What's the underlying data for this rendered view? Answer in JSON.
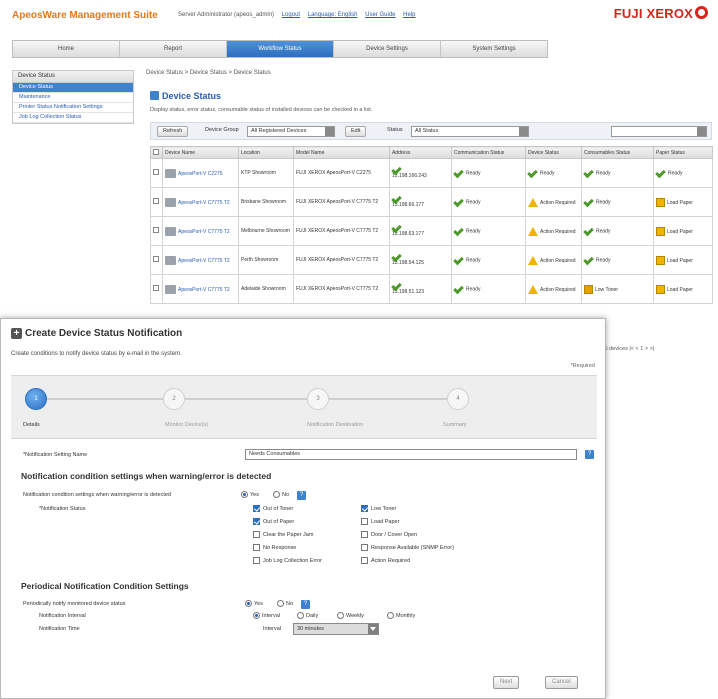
{
  "header": {
    "app_title": "ApeosWare Management Suite",
    "user_text": "Server Administrator (apeos_admin)",
    "logout": "Logout",
    "language": "Language: English",
    "user_guide": "User Guide",
    "help": "Help",
    "brand": "FUJI XEROX"
  },
  "nav": [
    "Home",
    "Report",
    "Workflow Status",
    "Device Settings",
    "System Settings"
  ],
  "sidebar": {
    "header": "Device Status",
    "items": [
      "Device Status",
      "Maintenance",
      "Printer Status Notification Settings",
      "Job Log Collection Status"
    ]
  },
  "background": {
    "breadcrumb": "Device Status  >  Device Status  >  Device Status",
    "title": "Device Status",
    "description": "Display status, error status, consumable status of installed devices can be checked in a list.",
    "toolbar": {
      "button_left": "Refresh",
      "group_label": "Device Group",
      "group_value": "All Registered Devices",
      "edit": "Edit",
      "status_label": "Status",
      "status_value": "All Status"
    },
    "columns": [
      "",
      "Device Name",
      "Location",
      "Model Name",
      "Address",
      "Communication Status",
      "Device Status",
      "Consumables Status",
      "Paper Status"
    ],
    "rows": [
      {
        "name": "ApeosPort-V C2275",
        "location": "KTP Showroom",
        "model": "FUJI XEROX ApeosPort-V C2275",
        "address": "13.198.166.243",
        "comm": "Ready",
        "device": "Ready",
        "device_warn": false,
        "cons": "Ready",
        "cons_warn": false,
        "paper": "Ready",
        "paper_warn": false
      },
      {
        "name": "ApeosPort-V C7775 T2",
        "location": "Brisbane Showroom",
        "model": "FUJI XEROX ApeosPort-V C7775 T2",
        "address": "13.198.66.177",
        "comm": "Ready",
        "device": "Action Required",
        "device_warn": true,
        "cons": "Ready",
        "cons_warn": false,
        "paper": "Load Paper",
        "paper_warn": true
      },
      {
        "name": "ApeosPort-V C7775 T2",
        "location": "Melbourne Showroom",
        "model": "FUJI XEROX ApeosPort-V C7775 T2",
        "address": "13.198.63.177",
        "comm": "Ready",
        "device": "Action Required",
        "device_warn": true,
        "cons": "Ready",
        "cons_warn": false,
        "paper": "Load Paper",
        "paper_warn": true
      },
      {
        "name": "ApeosPort-V C7775 T2",
        "location": "Perth Showroom",
        "model": "FUJI XEROX ApeosPort-V C7775 T2",
        "address": "13.198.54.125",
        "comm": "Ready",
        "device": "Action Required",
        "device_warn": true,
        "cons": "Ready",
        "cons_warn": false,
        "paper": "Load Paper",
        "paper_warn": true
      },
      {
        "name": "ApeosPort-V C7775 T2",
        "location": "Adelaide Showroom",
        "model": "FUJI XEROX ApeosPort-V C7775 T2",
        "address": "13.198.51.123",
        "comm": "Ready",
        "device": "Action Required",
        "device_warn": true,
        "cons": "Low Toner",
        "cons_warn": true,
        "paper": "Load Paper",
        "paper_warn": true
      }
    ],
    "pager": "6/6 devices   |<   <   1   >   >|"
  },
  "modal": {
    "title": "Create Device Status Notification",
    "description": "Create conditions to notify device status by e-mail in the system.",
    "required_note": "*Required",
    "steps": [
      {
        "num": "1",
        "label": "Details"
      },
      {
        "num": "2",
        "label": "Monitor Device(s)"
      },
      {
        "num": "3",
        "label": "Notification Destination"
      },
      {
        "num": "4",
        "label": "Summary"
      }
    ],
    "setting_name_label": "*Notification Setting Name",
    "setting_name_value": "Needs Consumables",
    "section1_title": "Notification condition settings when warning/error is detected",
    "condition_question": "Notification condition settings when warning/error is detected",
    "yes": "Yes",
    "no": "No",
    "status_label": "*Notification Status",
    "statuses": [
      {
        "label": "Out of Toner",
        "checked": true
      },
      {
        "label": "Low Toner",
        "checked": true
      },
      {
        "label": "Out of Paper",
        "checked": true
      },
      {
        "label": "Load Paper",
        "checked": false
      },
      {
        "label": "Clear the Paper Jam",
        "checked": false
      },
      {
        "label": "Door / Cover Open",
        "checked": false
      },
      {
        "label": "No Response",
        "checked": false
      },
      {
        "label": "Response Available (SNMP Error)",
        "checked": false
      },
      {
        "label": "Job Log Collection Error",
        "checked": false
      },
      {
        "label": "Action Required",
        "checked": false
      }
    ],
    "section2_title": "Periodical Notification Condition Settings",
    "periodic_question": "Periodically notify monitored device status",
    "interval_label": "Notification Interval",
    "interval_options": [
      "Interval",
      "Daily",
      "Weekly",
      "Monthly"
    ],
    "time_label": "Notification Time",
    "interval_field_label": "Interval",
    "interval_value": "30 minutes",
    "next_button": "Next",
    "cancel_button": "Cancel"
  }
}
